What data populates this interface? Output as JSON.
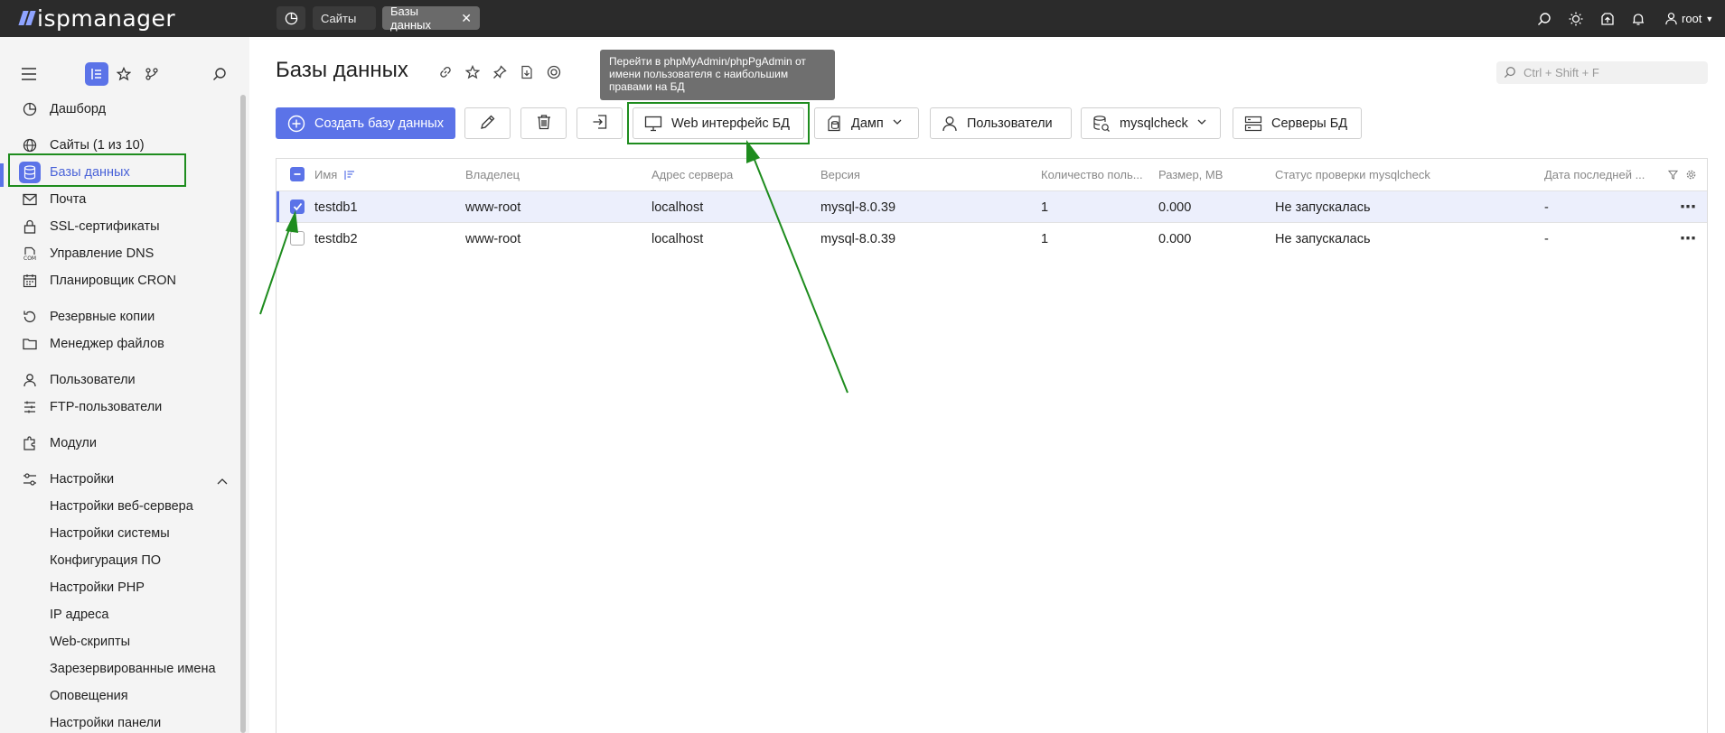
{
  "topbar": {
    "logo_text": "ispmanager",
    "tabs": [
      {
        "label": "Сайты"
      },
      {
        "label": "Базы данных"
      }
    ],
    "user": "root"
  },
  "sidebar": {
    "items": [
      {
        "label": "Дашборд",
        "icon": "dashboard-icon"
      },
      {
        "label": "Сайты (1 из 10)",
        "icon": "globe-icon"
      },
      {
        "label": "Базы данных",
        "icon": "database-icon"
      },
      {
        "label": "Почта",
        "icon": "mail-icon"
      },
      {
        "label": "SSL-сертификаты",
        "icon": "lock-icon"
      },
      {
        "label": "Управление DNS",
        "icon": "dns-icon"
      },
      {
        "label": "Планировщик CRON",
        "icon": "calendar-icon"
      },
      {
        "label": "Резервные копии",
        "icon": "backup-icon"
      },
      {
        "label": "Менеджер файлов",
        "icon": "folder-icon"
      },
      {
        "label": "Пользователи",
        "icon": "user-icon"
      },
      {
        "label": "FTP-пользователи",
        "icon": "ftp-icon"
      },
      {
        "label": "Модули",
        "icon": "modules-icon"
      },
      {
        "label": "Настройки",
        "icon": "settings-icon"
      }
    ],
    "settings_children": [
      "Настройки веб-сервера",
      "Настройки системы",
      "Конфигурация ПО",
      "Настройки PHP",
      "IP адреса",
      "Web-скрипты",
      "Зарезервированные имена",
      "Оповещения",
      "Настройки панели"
    ]
  },
  "main": {
    "title": "Базы данных",
    "search_placeholder": "Ctrl + Shift + F",
    "tooltip": "Перейти в phpMyAdmin/phpPgAdmin от имени пользователя с наибольшим правами на БД",
    "toolbar": {
      "create": "Создать базу данных",
      "webui": "Web интерфейс БД",
      "dump": "Дамп",
      "users": "Пользователи",
      "check": "mysqlcheck",
      "servers": "Серверы БД"
    },
    "columns": [
      "Имя",
      "Владелец",
      "Адрес сервера",
      "Версия",
      "Количество поль...",
      "Размер, MB",
      "Статус проверки mysqlcheck",
      "Дата последней ..."
    ],
    "rows": [
      {
        "name": "testdb1",
        "owner": "www-root",
        "server": "localhost",
        "version": "mysql-8.0.39",
        "users": "1",
        "size": "0.000",
        "status": "Не запускалась",
        "date": "-",
        "checked": true
      },
      {
        "name": "testdb2",
        "owner": "www-root",
        "server": "localhost",
        "version": "mysql-8.0.39",
        "users": "1",
        "size": "0.000",
        "status": "Не запускалась",
        "date": "-",
        "checked": false
      }
    ]
  },
  "colors": {
    "accent": "#5b73e8",
    "annotation": "#1e8c1e",
    "topbar": "#2b2b2b"
  }
}
